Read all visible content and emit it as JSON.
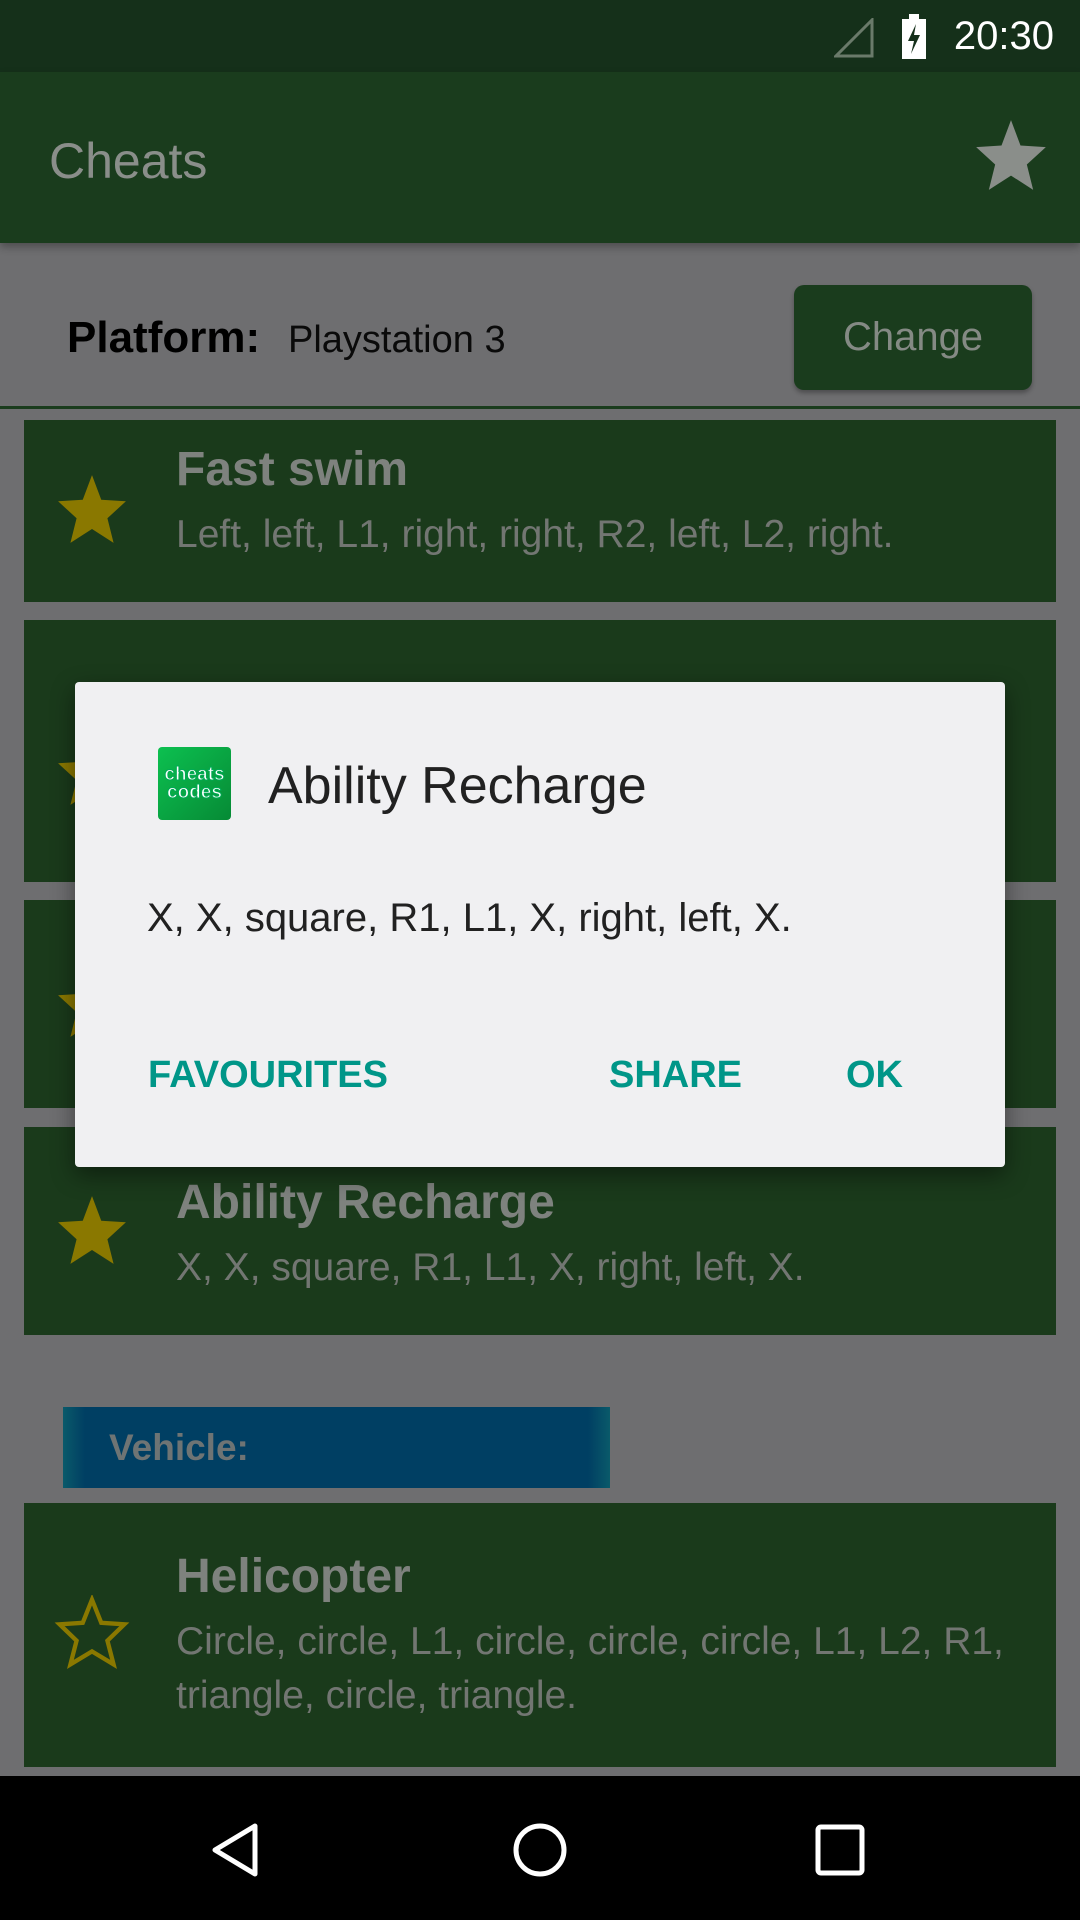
{
  "status_bar": {
    "time": "20:30",
    "icons": [
      "signal-icon",
      "battery-charging-icon"
    ]
  },
  "app_bar": {
    "title": "Cheats",
    "favourites_icon": "star-icon"
  },
  "platform": {
    "label": "Platform:",
    "value": "Playstation 3",
    "change_label": "Change"
  },
  "cheats": [
    {
      "title": "Fast swim",
      "description": "Left, left, L1, right, right, R2, left, L2, right.",
      "favourite": true
    },
    {
      "title": "",
      "description": "",
      "favourite": true
    },
    {
      "title": "",
      "description": "",
      "favourite": true
    },
    {
      "title": "Ability Recharge",
      "description": "X, X, square, R1, L1, X, right, left, X.",
      "favourite": true
    }
  ],
  "sections": [
    {
      "header": "Vehicle:",
      "cheats": [
        {
          "title": "Helicopter",
          "description": "Circle, circle, L1, circle, circle, circle, L1, L2, R1, triangle, circle, triangle.",
          "favourite": false
        }
      ]
    }
  ],
  "dialog": {
    "title": "Ability Recharge",
    "body": "X, X, square, R1, L1, X, right, left, X.",
    "icon_text": [
      "cheats",
      "codes"
    ],
    "buttons": {
      "favourites": "FAVOURITES",
      "share": "SHARE",
      "ok": "OK"
    }
  },
  "colors": {
    "primary": "#388e3c",
    "accent": "#009688",
    "section": "#0277bd",
    "star": "#c8a800"
  }
}
